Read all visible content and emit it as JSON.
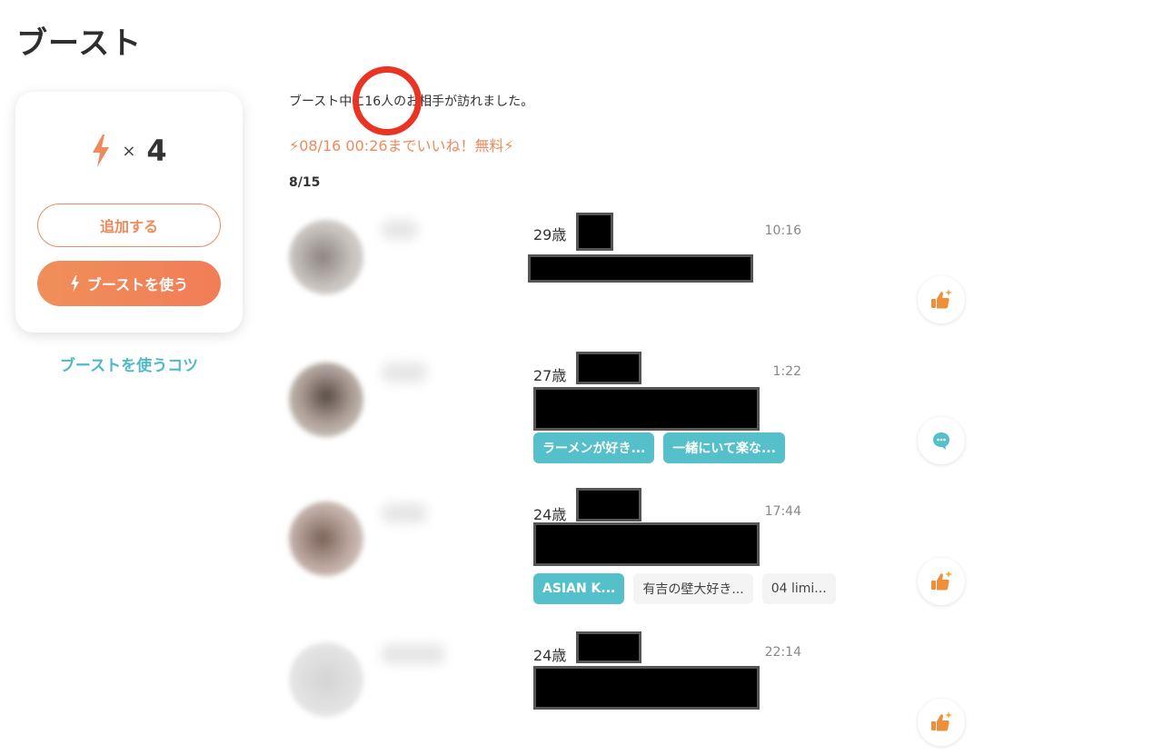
{
  "page": {
    "title": "ブースト"
  },
  "boost": {
    "multiplier": "×",
    "count": "4",
    "add_label": "追加する",
    "use_label": "ブーストを使う",
    "tips_label": "ブーストを使うコツ"
  },
  "info": {
    "visitors_prefix": "ブースト中に",
    "visitors_count": "16人",
    "visitors_suffix": "のお相手が訪れました。",
    "free_like": "⚡08/16 00:26までいいね！無料⚡",
    "date": "8/15"
  },
  "colors": {
    "accent": "#ef8a5c",
    "teal": "#55c0ca",
    "highlight": "#ea3323"
  },
  "visitors": [
    {
      "age": "29歳",
      "time": "10:16",
      "action": "like-icon",
      "tags": []
    },
    {
      "age": "27歳",
      "time": "1:22",
      "action": "message-icon",
      "tags": [
        {
          "label": "ラーメンが好き...",
          "style": "teal"
        },
        {
          "label": "一緒にいて楽な...",
          "style": "teal"
        }
      ]
    },
    {
      "age": "24歳",
      "time": "17:44",
      "action": "like-icon",
      "tags": [
        {
          "label": "ASIAN K...",
          "style": "teal"
        },
        {
          "label": "有吉の壁大好き...",
          "style": "gray"
        },
        {
          "label": "04 limi...",
          "style": "gray"
        }
      ]
    },
    {
      "age": "24歳",
      "time": "22:14",
      "action": "like-icon",
      "tags": []
    }
  ]
}
